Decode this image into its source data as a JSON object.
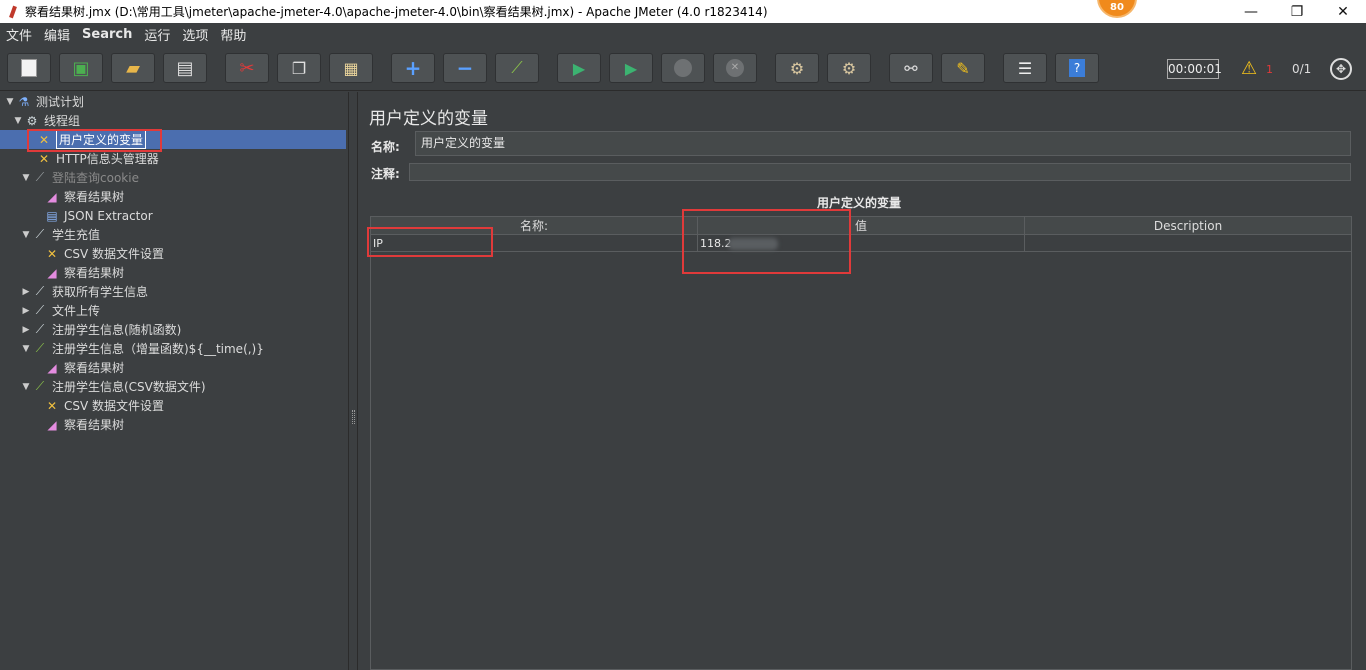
{
  "window": {
    "title": "察看结果树.jmx (D:\\常用工具\\jmeter\\apache-jmeter-4.0\\apache-jmeter-4.0\\bin\\察看结果树.jmx) - Apache JMeter (4.0 r1823414)",
    "badge": "80",
    "minimize": "—",
    "restore": "❐",
    "close": "✕"
  },
  "menu": [
    "文件",
    "编辑",
    "Search",
    "运行",
    "选项",
    "帮助"
  ],
  "toolbar": {
    "timer": "00:00:01",
    "error_count": "1",
    "threads": "0/1"
  },
  "tree": [
    {
      "label": "测试计划",
      "icon": "flask-icon",
      "arrow": "▼"
    },
    {
      "label": "线程组",
      "icon": "gear-icon",
      "arrow": "▼"
    },
    {
      "label": "用户定义的变量",
      "icon": "tools-icon",
      "arrow": ""
    },
    {
      "label": "HTTP信息头管理器",
      "icon": "tools-icon",
      "arrow": ""
    },
    {
      "label": "登陆查询cookie",
      "icon": "pipette-icon",
      "arrow": "▼"
    },
    {
      "label": "察看结果树",
      "icon": "chart-icon",
      "arrow": ""
    },
    {
      "label": "JSON Extractor",
      "icon": "document-icon",
      "arrow": ""
    },
    {
      "label": "学生充值",
      "icon": "pipette-icon",
      "arrow": "▼"
    },
    {
      "label": "CSV 数据文件设置",
      "icon": "tools-icon",
      "arrow": ""
    },
    {
      "label": "察看结果树",
      "icon": "chart-icon",
      "arrow": ""
    },
    {
      "label": "获取所有学生信息",
      "icon": "pipette-icon",
      "arrow": "▶"
    },
    {
      "label": "文件上传",
      "icon": "pipette-icon",
      "arrow": "▶"
    },
    {
      "label": "注册学生信息(随机函数)",
      "icon": "pipette-icon",
      "arrow": "▶"
    },
    {
      "label": "注册学生信息（增量函数)${__time(,)}",
      "icon": "pipette-icon",
      "arrow": "▼"
    },
    {
      "label": "察看结果树",
      "icon": "chart-icon",
      "arrow": ""
    },
    {
      "label": "注册学生信息(CSV数据文件)",
      "icon": "pipette-icon",
      "arrow": "▼"
    },
    {
      "label": "CSV 数据文件设置",
      "icon": "tools-icon",
      "arrow": ""
    },
    {
      "label": "察看结果树",
      "icon": "chart-icon",
      "arrow": ""
    }
  ],
  "panel": {
    "title": "用户定义的变量",
    "name_label": "名称:",
    "name_value": "用户定义的变量",
    "comment_label": "注释:",
    "comment_value": "",
    "section_title": "用户定义的变量",
    "columns": [
      "名称:",
      "值",
      "Description"
    ],
    "rows": [
      {
        "name": "IP",
        "value": "118.2",
        "description": ""
      }
    ]
  }
}
